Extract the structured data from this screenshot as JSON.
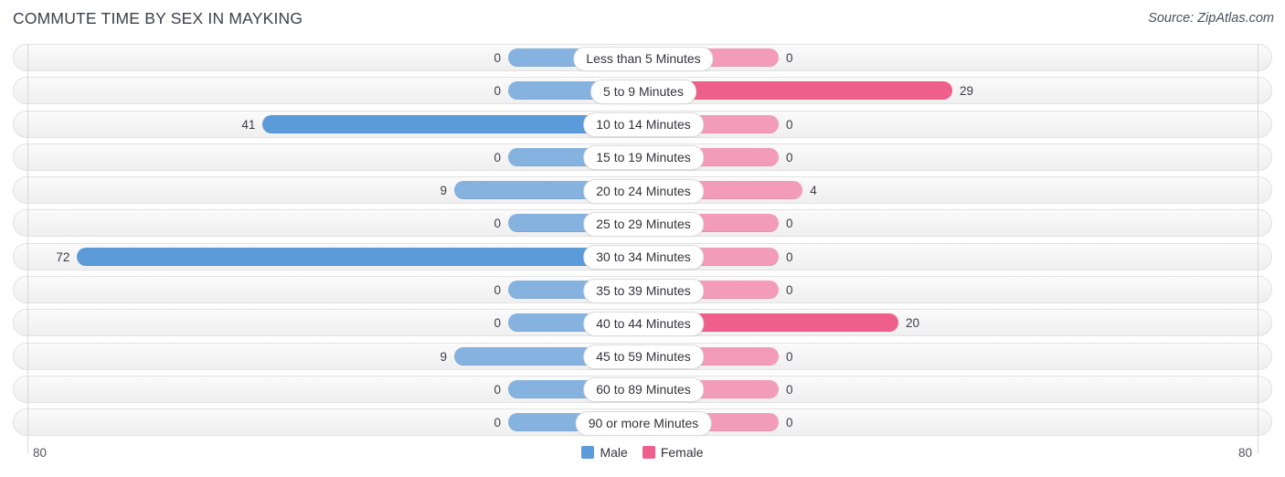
{
  "header": {
    "title": "COMMUTE TIME BY SEX IN MAYKING",
    "source": "Source: ZipAtlas.com"
  },
  "axis": {
    "left_tick": "80",
    "right_tick": "80"
  },
  "legend": {
    "items": [
      {
        "label": "Male",
        "color": "#5b9bd9"
      },
      {
        "label": "Female",
        "color": "#ef5f8b"
      }
    ]
  },
  "chart_data": {
    "type": "bar",
    "title": "COMMUTE TIME BY SEX IN MAYKING",
    "subtitle": "Source: ZipAtlas.com",
    "orientation": "horizontal-diverging",
    "xlabel": "",
    "ylabel": "",
    "xlim": [
      -80,
      80
    ],
    "axis_ticks": [
      "80",
      "80"
    ],
    "grid": false,
    "legend_position": "bottom-center",
    "categories": [
      "Less than 5 Minutes",
      "5 to 9 Minutes",
      "10 to 14 Minutes",
      "15 to 19 Minutes",
      "20 to 24 Minutes",
      "25 to 29 Minutes",
      "30 to 34 Minutes",
      "35 to 39 Minutes",
      "40 to 44 Minutes",
      "45 to 59 Minutes",
      "60 to 89 Minutes",
      "90 or more Minutes"
    ],
    "series": [
      {
        "name": "Male",
        "color": "#5b9bd9",
        "color_zero": "#86b2e0",
        "side": "left",
        "values": [
          0,
          0,
          41,
          0,
          9,
          0,
          72,
          0,
          0,
          9,
          0,
          0
        ],
        "labels": [
          "0",
          "0",
          "41",
          "0",
          "9",
          "0",
          "72",
          "0",
          "0",
          "9",
          "0",
          "0"
        ]
      },
      {
        "name": "Female",
        "color": "#ef5f8b",
        "color_zero": "#f39cb9",
        "side": "right",
        "values": [
          0,
          29,
          0,
          0,
          4,
          0,
          0,
          0,
          20,
          0,
          0,
          0
        ],
        "labels": [
          "0",
          "29",
          "0",
          "0",
          "4",
          "0",
          "0",
          "0",
          "20",
          "0",
          "0",
          "0"
        ]
      }
    ]
  }
}
